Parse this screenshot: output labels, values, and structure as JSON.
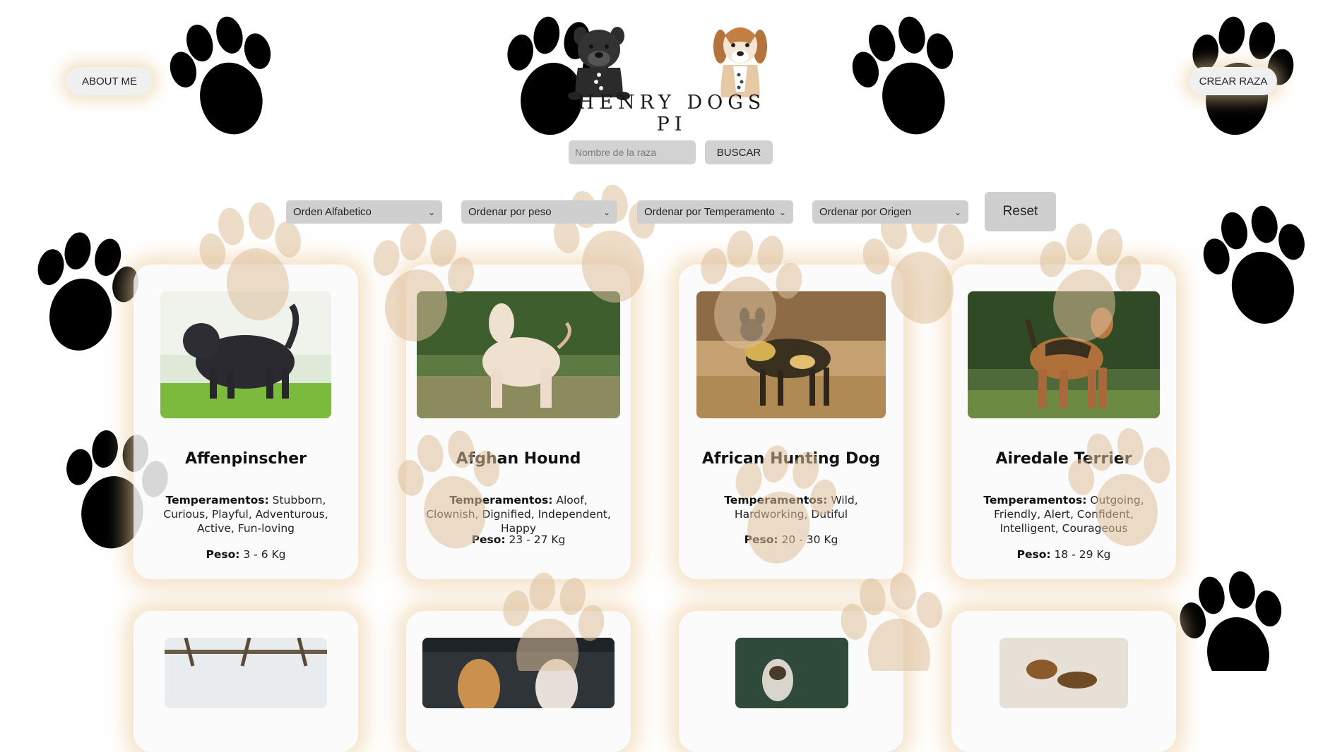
{
  "header": {
    "about_label": "ABOUT ME",
    "create_label": "CREAR RAZA",
    "logo_title": "HENRY DOGS PI"
  },
  "search": {
    "placeholder": "Nombre de la raza",
    "value": "",
    "button_label": "BUSCAR"
  },
  "filters": [
    {
      "label": "Orden Alfabetico"
    },
    {
      "label": "Ordenar por peso"
    },
    {
      "label": "Ordenar por Temperamento"
    },
    {
      "label": "Ordenar por Origen"
    }
  ],
  "reset_label": "Reset",
  "labels": {
    "temperament": "Temperamentos:",
    "weight": "Peso:"
  },
  "cards": [
    {
      "name": "Affenpinscher",
      "temperaments": "Stubborn, Curious, Playful, Adventurous, Active, Fun-loving",
      "weight": "3 - 6 Kg"
    },
    {
      "name": "Afghan Hound",
      "temperaments": "Aloof, Clownish, Dignified, Independent, Happy",
      "weight": "23 - 27 Kg"
    },
    {
      "name": "African Hunting Dog",
      "temperaments": "Wild, Hardworking, Dutiful",
      "weight": "20 - 30 Kg"
    },
    {
      "name": "Airedale Terrier",
      "temperaments": "Outgoing, Friendly, Alert, Confident, Intelligent, Courageous",
      "weight": "18 - 29 Kg"
    }
  ],
  "colors": {
    "paw": "#dcc09a",
    "card_glow": "#eecda0",
    "control_bg": "#cfcfcf"
  },
  "icons": {
    "logo": "two-dogs-logo-icon",
    "paw": "paw-print-icon",
    "dropdown": "chevron-down-icon"
  }
}
